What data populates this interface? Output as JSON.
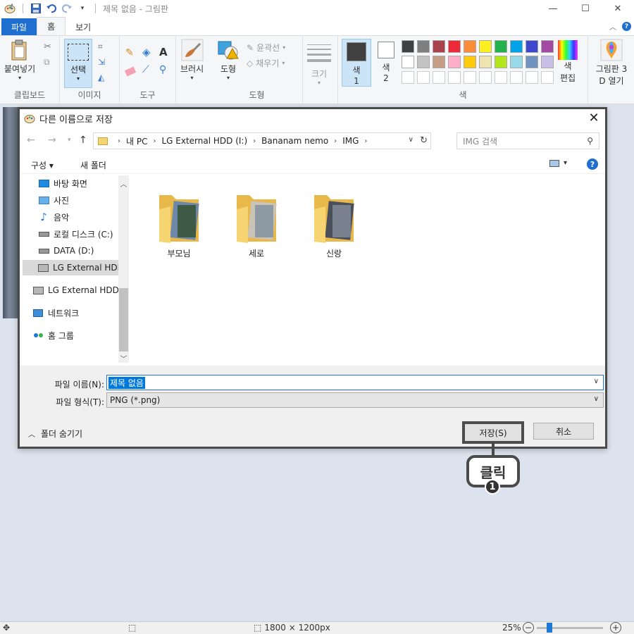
{
  "window": {
    "title": "제목 없음 - 그림판",
    "controls": {
      "minimize": "—",
      "maximize": "☐",
      "close": "✕"
    }
  },
  "ribbon": {
    "tabs": [
      "파일",
      "홈",
      "보기"
    ],
    "groups": {
      "clipboard": {
        "label": "클립보드",
        "paste": "붙여넣기"
      },
      "image": {
        "label": "이미지",
        "select": "선택"
      },
      "tools": {
        "label": "도구"
      },
      "brushes": {
        "label": "브러시"
      },
      "shapes": {
        "label": "도형",
        "shapes_btn": "도형",
        "outline": "윤곽선",
        "fill": "채우기"
      },
      "size": {
        "label": "크기"
      },
      "colors": {
        "label": "색",
        "color1_l1": "색",
        "color1_l2": "1",
        "color2_l1": "색",
        "color2_l2": "2",
        "edit_l1": "색",
        "edit_l2": "편집",
        "palette_row1": [
          "#404040",
          "#7f7f7f",
          "#a9424d",
          "#ec2a3a",
          "#fb8c3a",
          "#fdef21",
          "#22b14c",
          "#00a2e8",
          "#3f48cc",
          "#a349a4"
        ],
        "palette_row2": [
          "#ffffff",
          "#c3c3c3",
          "#c59e86",
          "#ffaec9",
          "#ffc90e",
          "#efe4b0",
          "#b5e61d",
          "#99d9ea",
          "#7092be",
          "#c8bfe7"
        ]
      },
      "paint3d": {
        "line1": "그림판 3",
        "line2": "D 열기"
      }
    }
  },
  "dialog": {
    "title": "다른 이름으로 저장",
    "breadcrumb": [
      "내 PC",
      "LG External HDD (I:)",
      "Bananam nemo",
      "IMG"
    ],
    "search_placeholder": "IMG 검색",
    "commands": {
      "organize": "구성 ▾",
      "new_folder": "새 폴더"
    },
    "nav_items": [
      {
        "label": "바탕 화면",
        "icon": "desktop-icon"
      },
      {
        "label": "사진",
        "icon": "pictures-icon"
      },
      {
        "label": "음악",
        "icon": "music-icon"
      },
      {
        "label": "로컬 디스크 (C:)",
        "icon": "drive-icon"
      },
      {
        "label": "DATA (D:)",
        "icon": "drive-icon"
      },
      {
        "label": "LG External HDD",
        "icon": "external-drive-icon"
      },
      {
        "label": "LG External HDD",
        "icon": "external-drive-icon"
      },
      {
        "label": "네트워크",
        "icon": "network-icon"
      },
      {
        "label": "홈 그룹",
        "icon": "homegroup-icon"
      }
    ],
    "folders": [
      "부모님",
      "세로",
      "신랑"
    ],
    "filename_label": "파일 이름(N):",
    "filename_value": "제목 없음",
    "filetype_label": "파일 형식(T):",
    "filetype_value": "PNG (*.png)",
    "hide_folders": "폴더 숨기기",
    "save_button": "저장(S)",
    "cancel_button": "취소"
  },
  "status": {
    "image_size": "1800 × 1200px",
    "zoom": "25%",
    "zoom_level": 0.25
  },
  "annotation": {
    "callout_text": "클릭",
    "step_number": "1"
  }
}
